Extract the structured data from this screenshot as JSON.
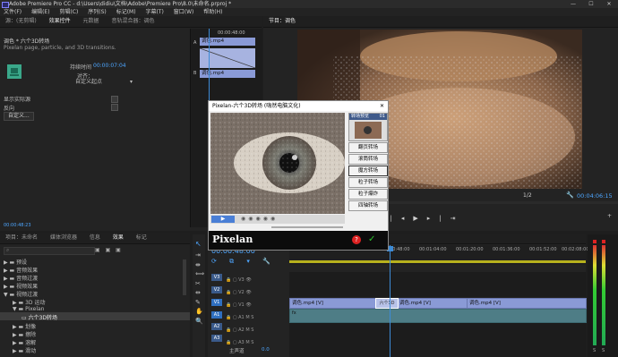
{
  "titlebar": {
    "title": "Adobe Premiere Pro CC - d:\\Users\\didiu\\文档\\Adobe\\Premiere Pro\\8.0\\未命名.prproj *",
    "minimize": "—",
    "maximize": "☐",
    "close": "✕"
  },
  "menubar": [
    "文件(F)",
    "编辑(E)",
    "剪辑(C)",
    "序列(S)",
    "标记(M)",
    "字幕(T)",
    "窗口(W)",
    "帮助(H)"
  ],
  "effect_controls": {
    "tabs": [
      "源：(无剪辑)",
      "效果控件",
      "元数据",
      "音轨混合器：调色"
    ],
    "active_tab": "效果控件",
    "header": "调色 * 六个3D转场",
    "subtitle": "Pixelan page, particle, and 3D transitions.",
    "duration_label": "持续时间",
    "duration_value": "00:00:07:04",
    "alignment_label": "对齐：",
    "alignment_value": "自定义起点",
    "show_actual_sources": "显示实际源",
    "reverse": "反向",
    "custom_button": "自定义...",
    "timecode_top": "00:00:48:00",
    "clip_a": "调色.mp4",
    "clip_b": "调色.mp4",
    "track_labels": [
      "A",
      "B"
    ],
    "bottom_timecode": "00:00:48:23"
  },
  "program_monitor": {
    "tab": "节目：调色",
    "fit": "1/2",
    "timecode": "00:04:06:15",
    "wrench": "wrench-icon"
  },
  "dialog": {
    "title": "Pixelan-六个3D转场 (嗨然电脑文化)",
    "preset_label": "转场预览",
    "preset_num": "01",
    "effects": [
      "翻页转场",
      "滚筒转场",
      "魔方转场",
      "粒子转场",
      "粒子爆炸",
      "四轴转场"
    ],
    "brand": "Pixelan",
    "brand_small": "Pixelan",
    "help": "?",
    "ok": "✓"
  },
  "project_panel": {
    "tabs": [
      "项目：未命名",
      "媒体浏览器",
      "信息",
      "效果",
      "标记"
    ],
    "active_tab": "效果",
    "tree": [
      {
        "label": "预设",
        "indent": 0
      },
      {
        "label": "音频效果",
        "indent": 0
      },
      {
        "label": "音频过渡",
        "indent": 0
      },
      {
        "label": "视频效果",
        "indent": 0
      },
      {
        "label": "视频过渡",
        "indent": 0
      },
      {
        "label": "3D 运动",
        "indent": 1
      },
      {
        "label": "Pixelan",
        "indent": 1
      },
      {
        "label": "六个3D转场",
        "indent": 2,
        "selected": true
      },
      {
        "label": "划像",
        "indent": 1
      },
      {
        "label": "擦除",
        "indent": 1
      },
      {
        "label": "溶解",
        "indent": 1
      },
      {
        "label": "滑动",
        "indent": 1
      }
    ]
  },
  "timeline": {
    "timecode": "00:00:48:00",
    "ruler": [
      "00:00",
      "00:00:16:00",
      "00:00:32:00",
      "00:00:48:00",
      "00:01:04:00",
      "00:01:20:00",
      "00:01:36:00",
      "00:01:52:00",
      "00:02:08:00"
    ],
    "video_tracks": [
      "V3",
      "V2",
      "V1"
    ],
    "audio_tracks": [
      "A1",
      "A2",
      "A3"
    ],
    "master_label": "主声道",
    "master_value": "0.0",
    "video_clips": [
      "调色.mp4 [V]",
      "调色.mp4 [V]",
      "调色.mp4 [V]",
      "调色.mp4 [V]"
    ],
    "transition_label": "六个3D",
    "audio_clip_label": "fx",
    "meter_labels": [
      "S",
      "S"
    ]
  },
  "colors": {
    "accent": "#4da6ff",
    "clip_video": "#8a9ad6",
    "clip_audio": "#4e7d86",
    "playhead": "#3d8bd6"
  }
}
